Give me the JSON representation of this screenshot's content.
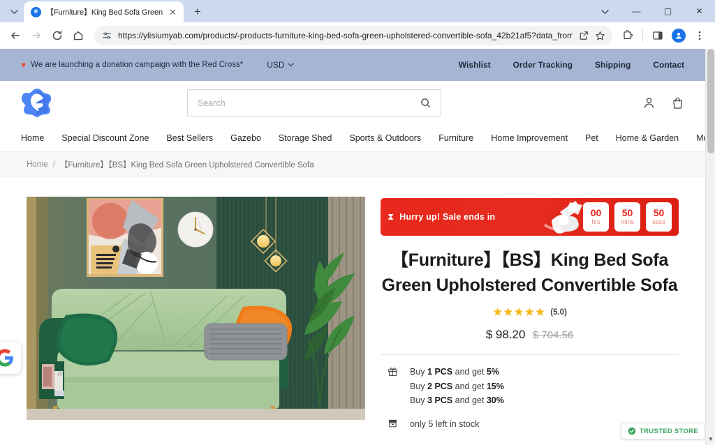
{
  "browser": {
    "tab": {
      "title": "【Furniture】King Bed Sofa Green",
      "favicon_letter": "e",
      "close_glyph": "✕"
    },
    "newtab_glyph": "+",
    "tab_search_icon": "chevron-down-icon",
    "window_controls": {
      "minimize": "—",
      "maximize": "▢",
      "close": "✕"
    },
    "toolbar": {
      "back": "←",
      "forward": "→",
      "reload": "⟳",
      "home": "⌂",
      "url": "https://ylisiumyab.com/products/-products-furniture-king-bed-sofa-green-upholstered-convertible-sofa_42b21af5?data_from=search_detail...",
      "share_icon": "share-icon",
      "bookmark_icon": "star-icon",
      "extensions_icon": "puzzle-icon",
      "sidepanel_icon": "side-panel-icon",
      "profile_icon": "profile-avatar-icon",
      "menu_icon": "three-dot-menu-icon"
    }
  },
  "announcement": {
    "heart_icon": "heart-icon",
    "message": "We are launching a donation campaign with the Red Cross*",
    "currency": "USD",
    "currency_caret": "⌄",
    "links": [
      "Wishlist",
      "Order Tracking",
      "Shipping",
      "Contact"
    ]
  },
  "header": {
    "logo_letter": "e",
    "search": {
      "placeholder": "Search",
      "value": "",
      "icon": "search-icon"
    },
    "account_icon": "person-icon",
    "cart_icon": "shopping-bag-icon"
  },
  "nav": {
    "items": [
      "Home",
      "Special Discount Zone",
      "Best Sellers",
      "Gazebo",
      "Storage Shed",
      "Sports & Outdoors",
      "Furniture",
      "Home Improvement",
      "Pet",
      "Home & Garden",
      "More link"
    ]
  },
  "breadcrumb": {
    "home": "Home",
    "separator": "/",
    "current": "【Furniture】【BS】King Bed Sofa Green Upholstered Convertible Sofa"
  },
  "product": {
    "countdown": {
      "hourglass_icon": "hourglass-icon",
      "label": "Hurry up!  Sale ends in",
      "units": [
        {
          "value": "00",
          "unit": "hrs"
        },
        {
          "value": "50",
          "unit": "mins"
        },
        {
          "value": "50",
          "unit": "secs"
        }
      ],
      "bg_color": "#e8281c"
    },
    "title_line1": "【Furniture】【BS】King Bed Sofa",
    "title_line2": "Green Upholstered Convertible Sofa",
    "rating": {
      "stars": "★★★★★",
      "score": "(5.0)",
      "star_color": "#f5b718"
    },
    "price_current": "$ 98.20",
    "price_original": "$ 704.56",
    "bulk_icon": "gift-icon",
    "bulk_offers": [
      {
        "prefix": "Buy ",
        "qty": "1 PCS",
        "middle": " and get ",
        "discount": "5%"
      },
      {
        "prefix": "Buy ",
        "qty": "2 PCS",
        "middle": " and get ",
        "discount": "15%"
      },
      {
        "prefix": "Buy ",
        "qty": "3 PCS",
        "middle": " and get ",
        "discount": "30%"
      }
    ],
    "stock_icon": "inventory-icon",
    "stock_text": "only 5 left in stock",
    "image_alt": "green upholstered convertible sofa in a green living room"
  },
  "widgets": {
    "google_badge_letter": "G",
    "trusted_store": {
      "label": "TRUSTED STORE",
      "icon": "check-shield-icon",
      "color": "#3aa55d"
    }
  }
}
